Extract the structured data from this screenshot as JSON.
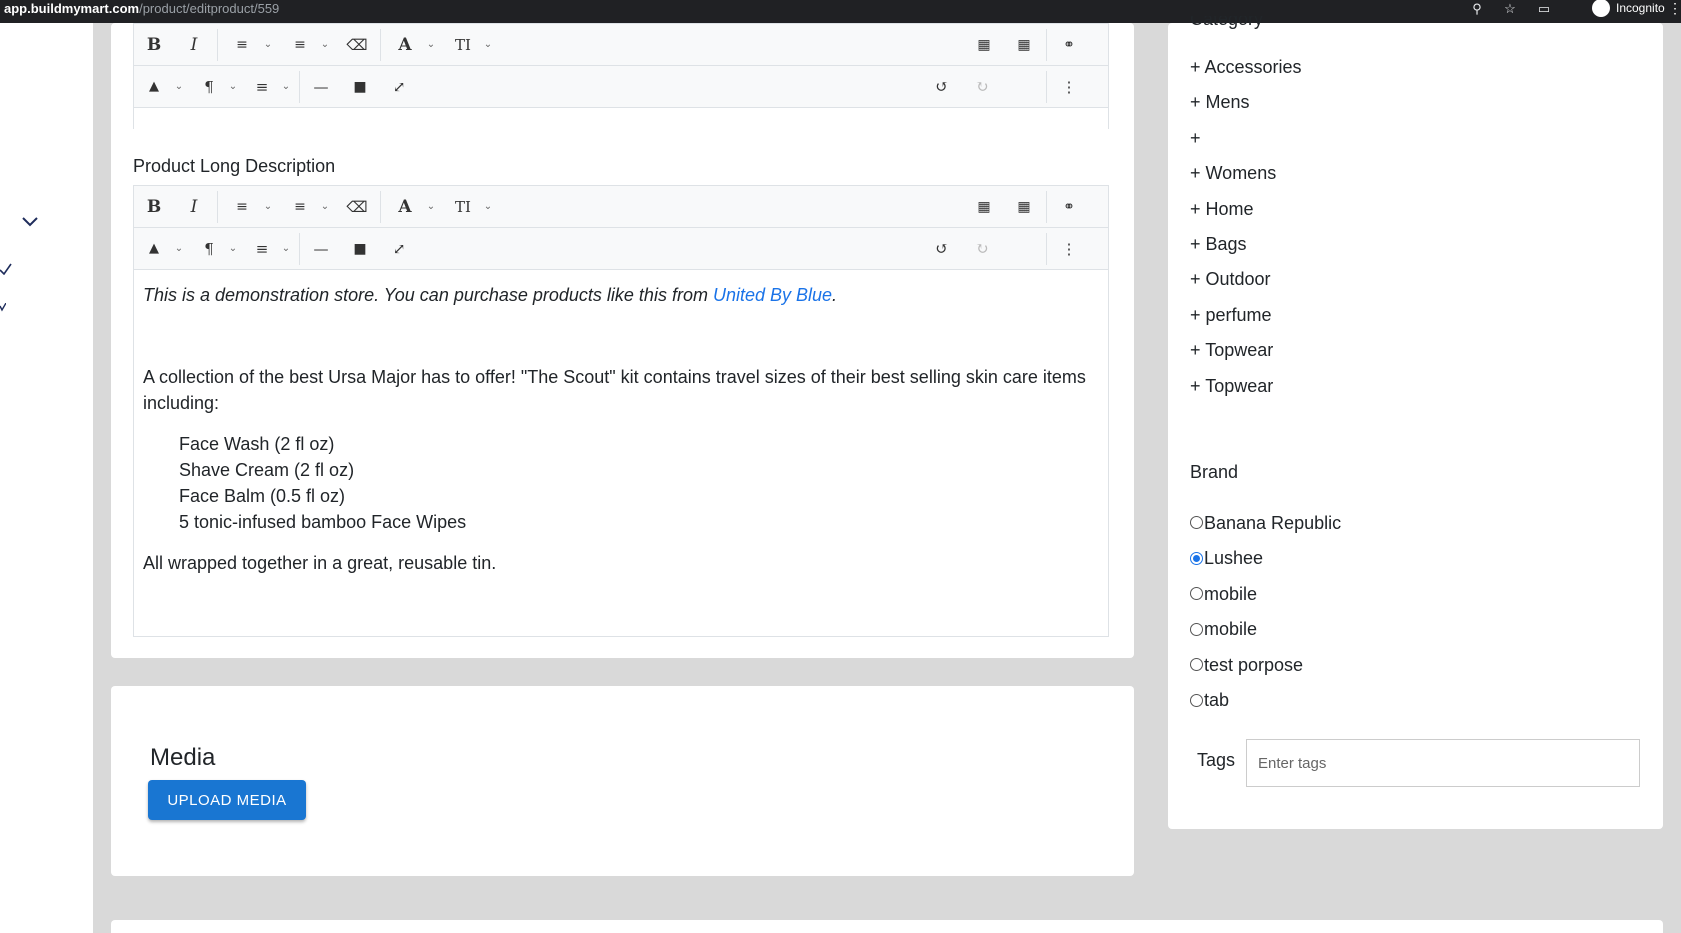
{
  "browser": {
    "url_host": "app.buildmymart.com",
    "url_path": "/product/editproduct/559",
    "profile_label": "Incognito",
    "zoom_icon": "zoom-icon",
    "star_icon": "bookmark-star-icon",
    "sidepanel_icon": "side-panel-icon",
    "menu_icon": "kebab-menu-icon"
  },
  "editor_toolbar": {
    "bold": "B",
    "italic": "I",
    "font_color": "A",
    "font_size": "TI"
  },
  "long_description": {
    "label": "Product Long Description",
    "demo_prefix": "This is a demonstration store. You can purchase products like this from ",
    "demo_link": "United By Blue",
    "demo_suffix": ".",
    "intro": "A collection of the best Ursa Major has to offer! \"The Scout\" kit contains travel sizes of their best selling skin care items including:",
    "items": [
      "Face Wash (2 fl oz)",
      "Shave Cream (2 fl oz)",
      "Face Balm (0.5 fl oz)",
      "5 tonic-infused bamboo Face Wipes"
    ],
    "closing": "All wrapped together in a great, reusable tin."
  },
  "media": {
    "title": "Media",
    "upload_label": "UPLOAD MEDIA"
  },
  "category": {
    "heading": "Category",
    "items": [
      "+ Accessories",
      "+ Mens",
      "+",
      "+ Womens",
      "+ Home",
      "+ Bags",
      "+ Outdoor",
      "+ perfume",
      "+ Topwear",
      "+ Topwear"
    ]
  },
  "brand": {
    "heading": "Brand",
    "options": [
      {
        "label": "Banana Republic",
        "selected": false
      },
      {
        "label": "Lushee",
        "selected": true
      },
      {
        "label": "mobile",
        "selected": false
      },
      {
        "label": "mobile",
        "selected": false
      },
      {
        "label": "test porpose",
        "selected": false
      },
      {
        "label": "tab",
        "selected": false
      }
    ]
  },
  "tags": {
    "label": "Tags",
    "placeholder": "Enter tags"
  },
  "colors": {
    "accent": "#1976d2",
    "link": "#1a73e8",
    "page_bg": "#d9d9d9"
  }
}
